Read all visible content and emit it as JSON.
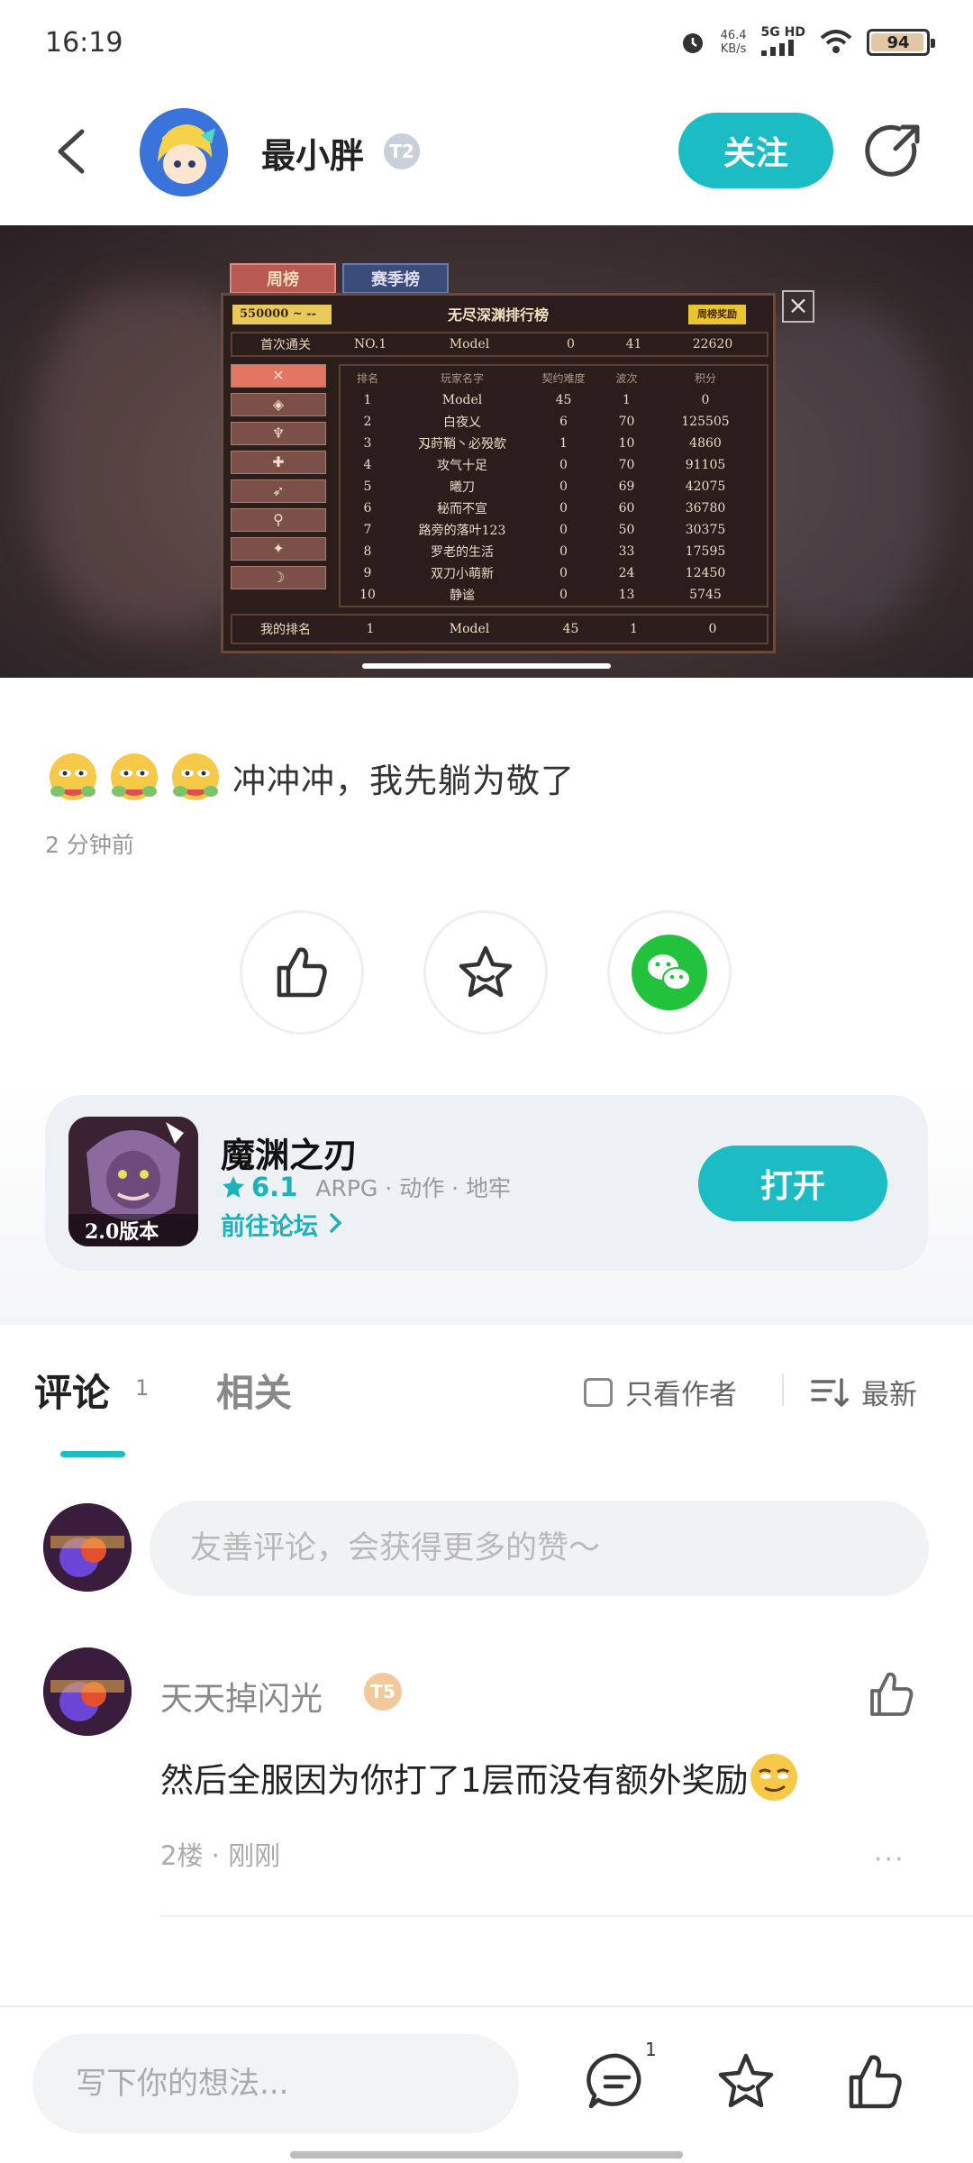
{
  "status_bar": {
    "time": "16:19",
    "speed_value": "46.4",
    "speed_unit": "KB/s",
    "network": "5G HD",
    "battery": "94"
  },
  "header": {
    "author_name": "最小胖",
    "author_level": "T2",
    "follow_label": "关注"
  },
  "screenshot": {
    "tab_week": "周榜",
    "tab_season": "赛季榜",
    "board_title": "无尽深渊排行榜",
    "score_range": "550000 ~ --",
    "reward_label": "周榜奖励",
    "first_clear": [
      "首次通关",
      "NO.1",
      "Model",
      "0",
      "41",
      "22620"
    ],
    "columns": [
      "排名",
      "玩家名字",
      "契约难度",
      "波次",
      "积分"
    ],
    "rows": [
      [
        "1",
        "Model",
        "45",
        "1",
        "0"
      ],
      [
        "2",
        "白夜乂",
        "6",
        "70",
        "125505"
      ],
      [
        "3",
        "刄莳鞘丶必殁欹",
        "1",
        "10",
        "4860"
      ],
      [
        "4",
        "攻气十足",
        "0",
        "70",
        "91105"
      ],
      [
        "5",
        "曦刀",
        "0",
        "69",
        "42075"
      ],
      [
        "6",
        "秘而不宣",
        "0",
        "60",
        "36780"
      ],
      [
        "7",
        "路旁的落叶123",
        "0",
        "50",
        "30375"
      ],
      [
        "8",
        "罗老的生活",
        "0",
        "33",
        "17595"
      ],
      [
        "9",
        "双刀小萌新",
        "0",
        "24",
        "12450"
      ],
      [
        "10",
        "静谧",
        "0",
        "13",
        "5745"
      ]
    ],
    "my_rank": [
      "我的排名",
      "1",
      "Model",
      "45",
      "1",
      "0"
    ]
  },
  "post": {
    "text": "冲冲冲，我先躺为敬了",
    "time": "2 分钟前"
  },
  "game_card": {
    "title": "魔渊之刃",
    "rating": "6.1",
    "tags": "ARPG · 动作 · 地牢",
    "forum_link": "前往论坛",
    "icon_text": "2.0版本",
    "open_label": "打开"
  },
  "tabs": {
    "comments_label": "评论",
    "comments_count": "1",
    "related_label": "相关",
    "only_author": "只看作者",
    "sort_label": "最新"
  },
  "comment_input": {
    "placeholder": "友善评论，会获得更多的赞～"
  },
  "comment": {
    "user": "天天掉闪光",
    "level": "T5",
    "text": "然后全服因为你打了1层而没有额外奖励",
    "meta": "2楼 · 刚刚",
    "more": "···"
  },
  "bottom_bar": {
    "placeholder": "写下你的想法...",
    "comment_count": "1"
  },
  "colors": {
    "accent": "#1bbcc3",
    "wechat": "#23c23d"
  }
}
